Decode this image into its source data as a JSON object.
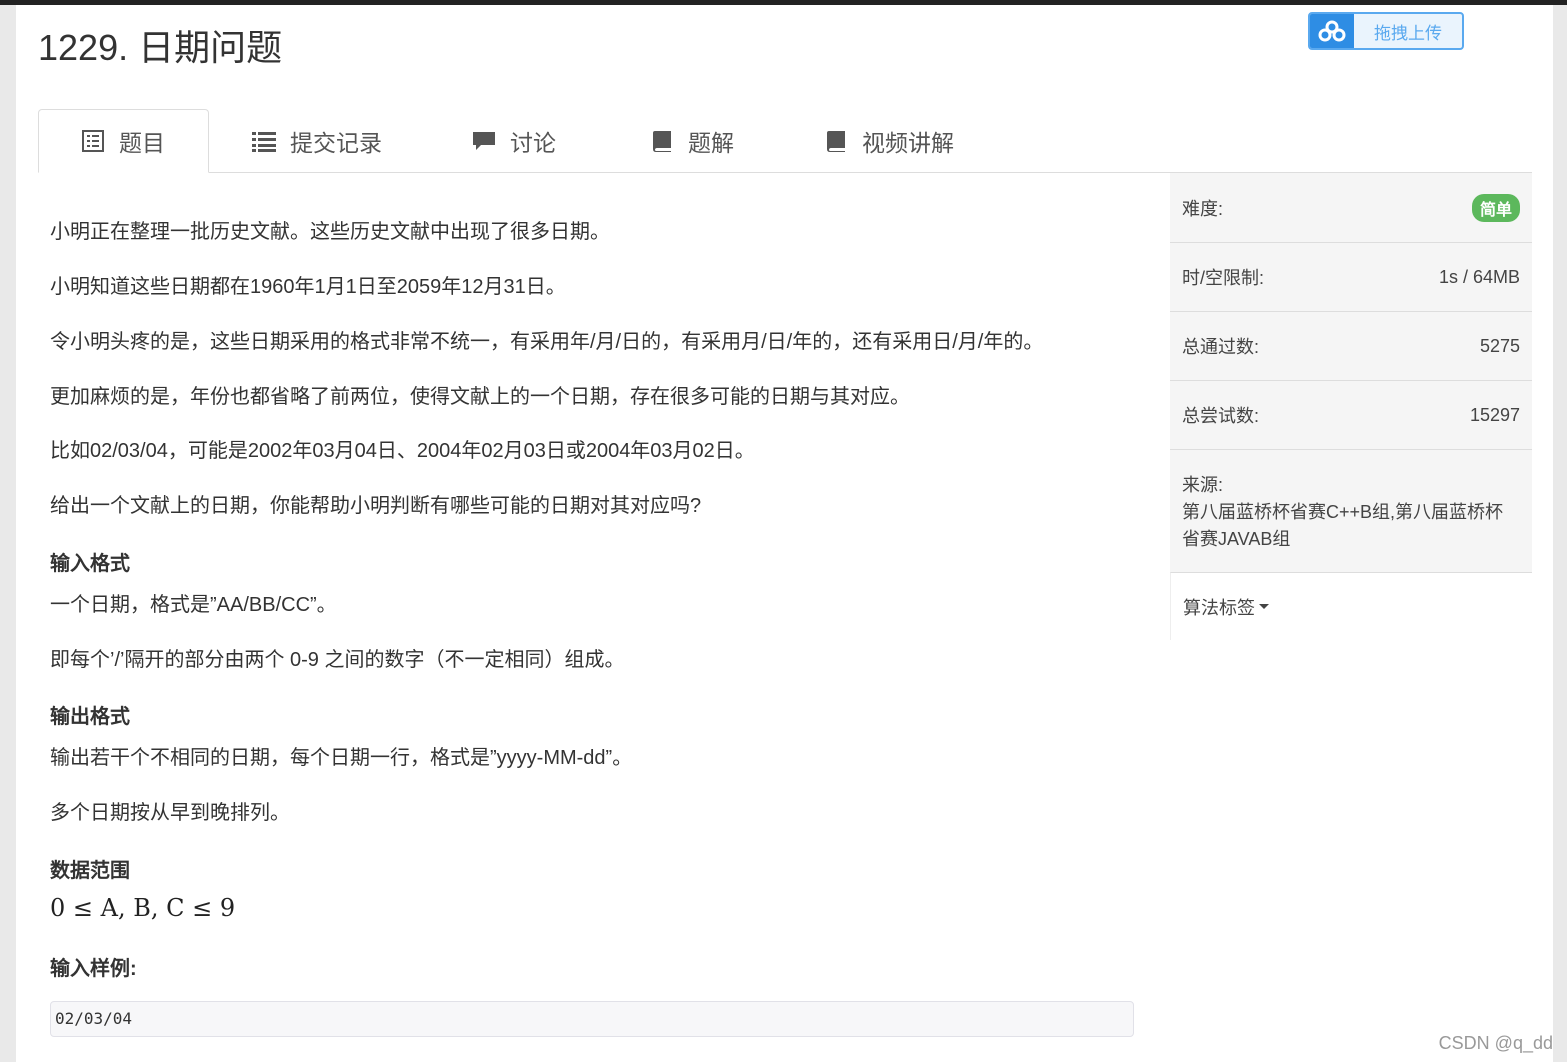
{
  "title": "1229. 日期问题",
  "upload_label": "拖拽上传",
  "tabs": [
    {
      "label": "题目"
    },
    {
      "label": "提交记录"
    },
    {
      "label": "讨论"
    },
    {
      "label": "题解"
    },
    {
      "label": "视频讲解"
    }
  ],
  "problem": {
    "paras": [
      "小明正在整理一批历史文献。这些历史文献中出现了很多日期。",
      "小明知道这些日期都在1960年1月1日至2059年12月31日。",
      "令小明头疼的是，这些日期采用的格式非常不统一，有采用年/月/日的，有采用月/日/年的，还有采用日/月/年的。",
      "更加麻烦的是，年份也都省略了前两位，使得文献上的一个日期，存在很多可能的日期与其对应。",
      "比如02/03/04，可能是2002年03月04日、2004年02月03日或2004年03月02日。",
      "给出一个文献上的日期，你能帮助小明判断有哪些可能的日期对其对应吗?"
    ],
    "input_heading": "输入格式",
    "input_paras": [
      "一个日期，格式是”AA/BB/CC”。",
      "即每个’/’隔开的部分由两个 0-9 之间的数字（不一定相同）组成。"
    ],
    "output_heading": "输出格式",
    "output_paras": [
      "输出若干个不相同的日期，每个日期一行，格式是”yyyy-MM-dd”。",
      "多个日期按从早到晚排列。"
    ],
    "range_heading": "数据范围",
    "range_math": "0 ≤ A, B, C ≤ 9",
    "sample_heading": "输入样例:",
    "sample_input": "02/03/04"
  },
  "sidebar": {
    "difficulty_label": "难度:",
    "difficulty_value": "简单",
    "limit_label": "时/空限制:",
    "limit_value": "1s / 64MB",
    "passed_label": "总通过数:",
    "passed_value": "5275",
    "tried_label": "总尝试数:",
    "tried_value": "15297",
    "source_label": "来源:",
    "source_value": "第八届蓝桥杯省赛C++B组,第八届蓝桥杯省赛JAVAB组",
    "tags_label": "算法标签"
  },
  "watermark": "CSDN @q_dd"
}
